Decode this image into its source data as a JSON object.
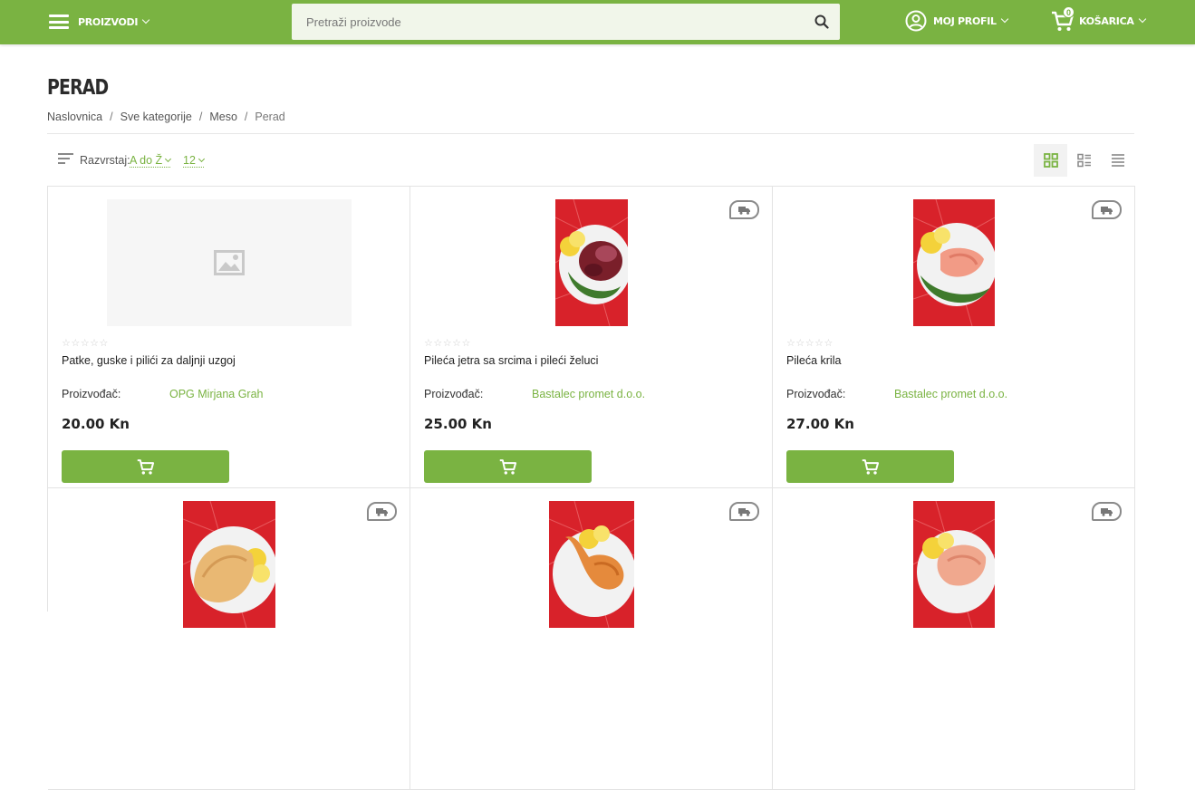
{
  "header": {
    "menu_label": "PROIZVODI",
    "search_placeholder": "Pretraži proizvode",
    "profile_label": "MOJ PROFIL",
    "cart_label": "KOŠARICA",
    "cart_count": "0",
    "accent_color": "#7ab342"
  },
  "page": {
    "title": "PERAD",
    "breadcrumb": [
      "Naslovnica",
      "Sve kategorije",
      "Meso",
      "Perad"
    ]
  },
  "toolbar": {
    "sort_label": "Razvrstaj:",
    "sort_value": "A do Ž",
    "per_page": "12",
    "views": [
      "grid-view-icon",
      "list-grid-view-icon",
      "list-view-icon"
    ],
    "active_view": "grid-view-icon"
  },
  "products": [
    {
      "name": "Patke, guske i pilići za daljnji uzgoj",
      "manufacturer_label": "Proizvođač:",
      "manufacturer": "OPG Mirjana Grah",
      "price": "20.00 Kn",
      "image": "placeholder-image-icon",
      "delivery_badge": false,
      "rating": 0
    },
    {
      "name": "Pileća jetra sa srcima i pileći želuci",
      "manufacturer_label": "Proizvođač:",
      "manufacturer": "Bastalec promet d.o.o.",
      "price": "25.00 Kn",
      "image": "chicken-liver-photo",
      "delivery_badge": true,
      "rating": 0
    },
    {
      "name": "Pileća krila",
      "manufacturer_label": "Proizvođač:",
      "manufacturer": "Bastalec promet d.o.o.",
      "price": "27.00 Kn",
      "image": "chicken-wings-photo",
      "delivery_badge": true,
      "rating": 0
    },
    {
      "image": "chicken-breast-photo",
      "delivery_badge": true
    },
    {
      "image": "chicken-leg-photo",
      "delivery_badge": true
    },
    {
      "image": "chicken-fillet-photo",
      "delivery_badge": true
    }
  ]
}
